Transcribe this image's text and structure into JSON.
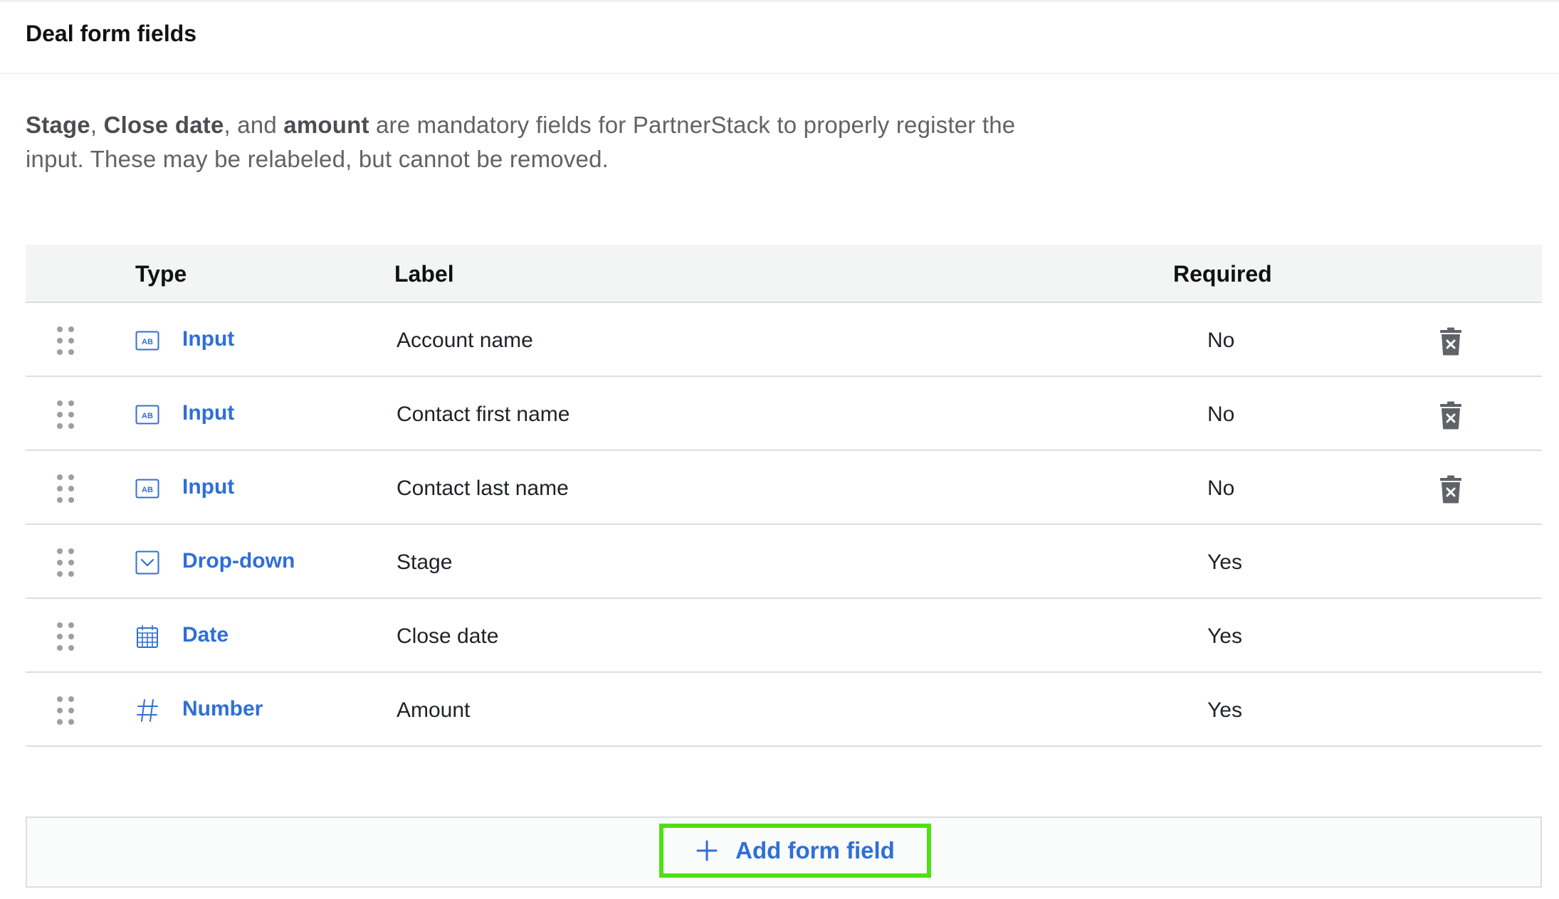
{
  "header": {
    "title": "Deal form fields"
  },
  "intro": {
    "field1": "Stage",
    "sep1": ", ",
    "field2": "Close date",
    "sep2": ", and ",
    "field3": "amount",
    "rest": " are mandatory fields for PartnerStack to properly register the input. These may be relabeled, but cannot be removed."
  },
  "table": {
    "headers": {
      "type": "Type",
      "label": "Label",
      "required": "Required"
    },
    "rows": [
      {
        "type": "Input",
        "icon": "text-input-icon",
        "label": "Account name",
        "required": "No",
        "deletable": true
      },
      {
        "type": "Input",
        "icon": "text-input-icon",
        "label": "Contact first name",
        "required": "No",
        "deletable": true
      },
      {
        "type": "Input",
        "icon": "text-input-icon",
        "label": "Contact last name",
        "required": "No",
        "deletable": true
      },
      {
        "type": "Drop-down",
        "icon": "dropdown-icon",
        "label": "Stage",
        "required": "Yes",
        "deletable": false
      },
      {
        "type": "Date",
        "icon": "calendar-icon",
        "label": "Close date",
        "required": "Yes",
        "deletable": false
      },
      {
        "type": "Number",
        "icon": "hash-icon",
        "label": "Amount",
        "required": "Yes",
        "deletable": false
      }
    ]
  },
  "add_button": {
    "label": "Add form field"
  },
  "colors": {
    "accent": "#2f6fd6",
    "highlight": "#4ee012",
    "icon_gray": "#9aa0a6",
    "trash": "#5f6368"
  }
}
